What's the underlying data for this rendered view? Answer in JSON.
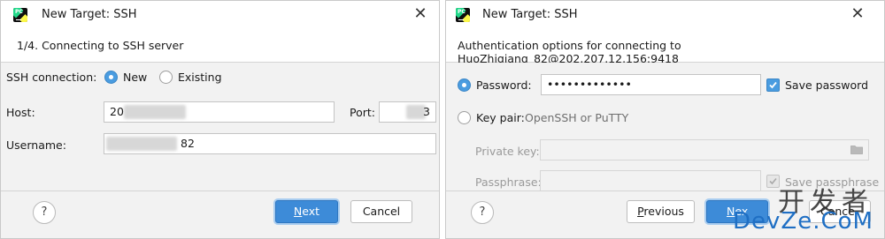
{
  "dialog1": {
    "title": "New Target: SSH",
    "close_glyph": "✕",
    "step_header": "1/4. Connecting to SSH server",
    "ssh_connection_label": "SSH connection:",
    "radio_new_label": "New",
    "radio_existing_label": "Existing",
    "host_label": "Host:",
    "host_value": "20",
    "port_label": "Port:",
    "port_value": "3",
    "username_label": "Username:",
    "username_value": "82",
    "help_glyph": "?",
    "next_label": "Next",
    "next_mnemonic": "N",
    "next_rest": "ext",
    "cancel_label": "Cancel"
  },
  "dialog2": {
    "title": "New Target: SSH",
    "close_glyph": "✕",
    "auth_header": "Authentication options for connecting to HuoZhiqiang_82@202.207.12.156:9418",
    "password_label": "Password:",
    "password_value": "•••••••••••••",
    "save_password_label": "Save password",
    "key_pair_label": "Key pair:",
    "key_pair_hint": "OpenSSH or PuTTY",
    "private_key_label": "Private key:",
    "passphrase_label": "Passphrase:",
    "save_passphrase_label": "Save passphrase",
    "help_glyph": "?",
    "previous_mnemonic": "P",
    "previous_rest": "revious",
    "next_mnemonic": "N",
    "next_rest": "ex",
    "cancel_label": "Cance"
  },
  "watermark": {
    "chinese": "开发者",
    "english": "DevZe.CoM"
  },
  "colors": {
    "accent": "#3d8bd8",
    "footer_bg": "#f2f2f2",
    "watermark_blue": "#1f6fc4"
  },
  "icons": {
    "app": "pycharm-icon",
    "folder": "folder-icon",
    "check": "check-icon"
  }
}
